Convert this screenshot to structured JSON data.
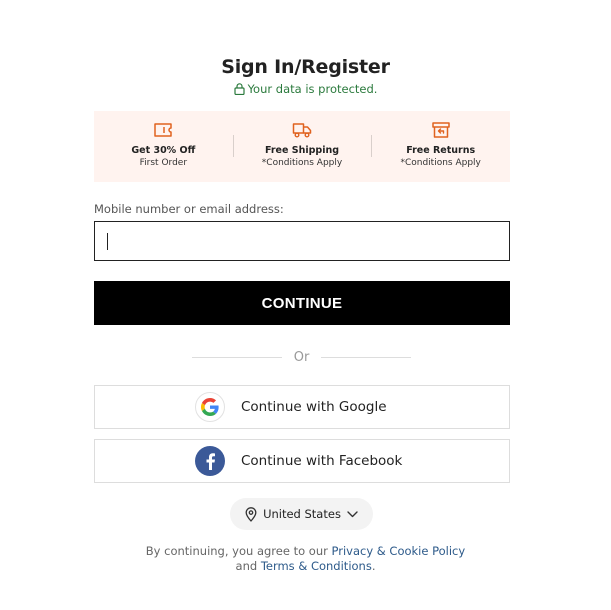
{
  "header": {
    "title": "Sign In/Register",
    "secure_text": "Your data is protected."
  },
  "benefits": [
    {
      "title": "Get 30% Off",
      "subtitle": "First Order",
      "icon": "coupon-icon"
    },
    {
      "title": "Free Shipping",
      "subtitle": "*Conditions Apply",
      "icon": "truck-icon"
    },
    {
      "title": "Free Returns",
      "subtitle": "*Conditions Apply",
      "icon": "return-box-icon"
    }
  ],
  "form": {
    "label": "Mobile number or email address:",
    "value": "",
    "continue_label": "CONTINUE"
  },
  "divider": {
    "text": "Or"
  },
  "social": {
    "google_label": "Continue with Google",
    "facebook_label": "Continue with Facebook"
  },
  "country": {
    "selected": "United States",
    "icon": "location-pin-icon"
  },
  "legal": {
    "prefix": "By continuing, you agree to our ",
    "privacy_link": "Privacy & Cookie Policy",
    "middle": " and ",
    "terms_link": "Terms & Conditions",
    "suffix": "."
  },
  "colors": {
    "accent": "#e0621f",
    "secure": "#2b7a3d",
    "benefit_bg": "#fff3ef",
    "button": "#000000",
    "facebook": "#3b5998",
    "link": "#2d5a8a"
  }
}
